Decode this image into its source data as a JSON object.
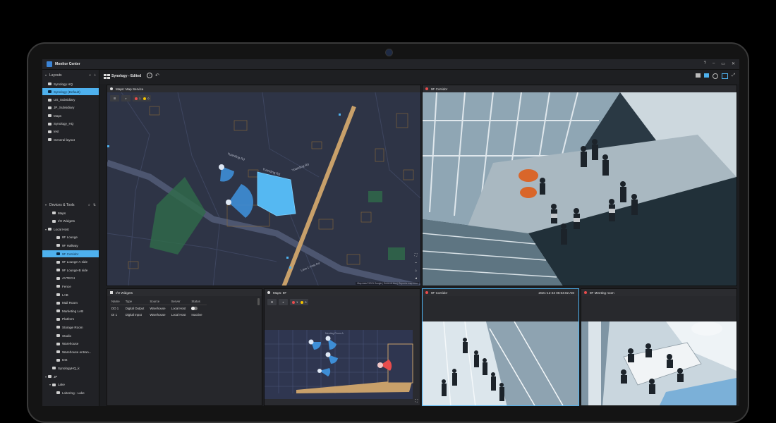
{
  "app": {
    "title": "Monitor Center"
  },
  "window_controls": [
    "?",
    "–",
    "▭",
    "✕"
  ],
  "layouts_section": {
    "title": "Layouts",
    "items": [
      {
        "label": "Synology HQ"
      },
      {
        "label": "Synology (Default)",
        "selected": true
      },
      {
        "label": "US_Subsidiary"
      },
      {
        "label": "JP_Subsidiary"
      },
      {
        "label": "Maps"
      },
      {
        "label": "Synology_HQ"
      },
      {
        "label": "test"
      },
      {
        "label": "General layout"
      }
    ]
  },
  "devices_section": {
    "title": "Devices & Tools",
    "items": [
      {
        "label": "Maps",
        "level": 1
      },
      {
        "label": "I/O Widgets",
        "level": 1
      },
      {
        "label": "Local Host",
        "level": 0,
        "expanded": true
      },
      {
        "label": "8F Lounge",
        "level": 2
      },
      {
        "label": "9F Hallway",
        "level": 2
      },
      {
        "label": "9F Corridor",
        "level": 2,
        "selected": true
      },
      {
        "label": "9F Lounge-A side",
        "level": 2
      },
      {
        "label": "9F Lounge-B side",
        "level": 2
      },
      {
        "label": "AVTECH",
        "level": 2
      },
      {
        "label": "Fence",
        "level": 2
      },
      {
        "label": "LAB",
        "level": 2
      },
      {
        "label": "Mail Room",
        "level": 2
      },
      {
        "label": "Marketing LAB",
        "level": 2
      },
      {
        "label": "Platform",
        "level": 2
      },
      {
        "label": "Storage Room",
        "level": 2
      },
      {
        "label": "Studio",
        "level": 2
      },
      {
        "label": "Warehouse",
        "level": 2
      },
      {
        "label": "Warehouse entran...",
        "level": 2
      },
      {
        "label": "test",
        "level": 2
      },
      {
        "label": "SynologyHQ_k",
        "level": 1
      },
      {
        "label": "JP",
        "level": 0,
        "expanded": true
      },
      {
        "label": "Lake",
        "level": 1,
        "expanded": true
      },
      {
        "label": "Loitering - Lake",
        "level": 2
      }
    ]
  },
  "toolbar": {
    "layout_name": "Synology - Edited"
  },
  "map_service": {
    "title": "Maps: Map Service",
    "alarm_count": "1",
    "warning_count": "0",
    "attribution": "Map data ©2021 Google | Terms of Use | Report a map error",
    "streets": [
      "Yuanding Rd",
      "Yuanding Rd",
      "Yuanding Rd",
      "Lane 1 Xinlu Rd"
    ]
  },
  "corridor_panel": {
    "title": "9F Corridor"
  },
  "io_widgets": {
    "title": "I/O Widgets",
    "columns": [
      "Name",
      "Type",
      "Source",
      "Server",
      "Status"
    ],
    "rows": [
      {
        "name": "DO 1",
        "type": "Digital Output",
        "source": "Warehouse",
        "server": "Local Host",
        "status": ""
      },
      {
        "name": "DI 1",
        "type": "Digital Input",
        "source": "Warehouse",
        "server": "Local Host",
        "status": "Inactive"
      }
    ]
  },
  "map_9f": {
    "title": "Maps: 9F",
    "alarm_count": "1",
    "warning_count": "0",
    "room_label": "Meeting Room A"
  },
  "corridor_small": {
    "title": "9F Corridor",
    "timestamp": "2021-12-23 06:04:02 AM"
  },
  "meeting_room": {
    "title": "9F Meeting room"
  },
  "colors": {
    "accent": "#4eb1ee",
    "map_bg": "#2e3446",
    "alarm": "#e84c4c",
    "warning": "#f2c200",
    "road": "#c8a06a"
  }
}
